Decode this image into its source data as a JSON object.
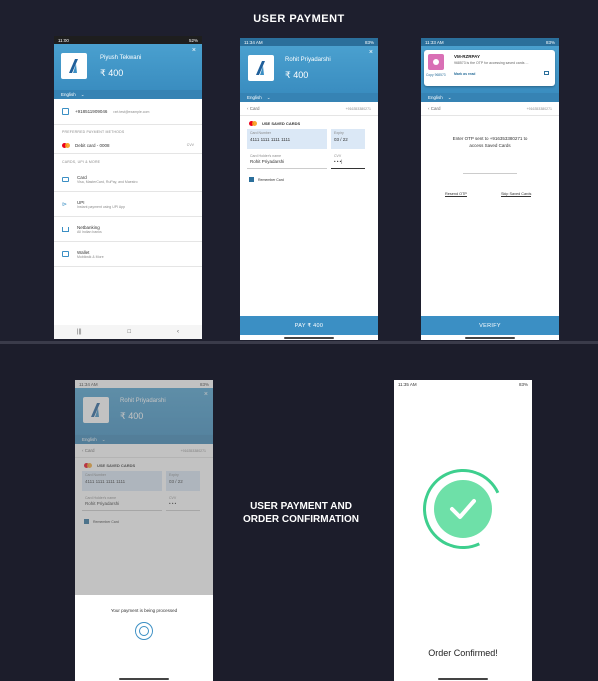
{
  "titles": {
    "main": "USER PAYMENT",
    "side": "USER PAYMENT AND ORDER CONFIRMATION"
  },
  "phone1": {
    "status_time": "11:00",
    "status_right": "52%",
    "name": "Piyush Tekwani",
    "amount": "₹ 400",
    "close": "×",
    "language": "English",
    "phone": "+918511909046",
    "email": "rzrt.test@example.com",
    "preferred_label": "PREFERRED PAYMENT METHODS",
    "debit_card": "Debit card - 0008",
    "cvv": "CVV",
    "cards_label": "CARDS, UPI & MORE",
    "methods": [
      {
        "title": "Card",
        "sub": "Visa, MasterCard, RuPay, and Maestro"
      },
      {
        "title": "UPI",
        "sub": "Instant payment using UPI App"
      },
      {
        "title": "Netbanking",
        "sub": "All Indian banks"
      },
      {
        "title": "Wallet",
        "sub": "Mobikwik & More"
      }
    ],
    "nav": [
      "|||",
      "□",
      "‹"
    ]
  },
  "phone2": {
    "status_time": "11:34 AM",
    "status_right": "83%",
    "name": "Rohit Priyadarshi",
    "amount": "₹ 400",
    "close": "×",
    "language": "English",
    "back_label": "‹  Card",
    "phone": "+916353380271",
    "saved_cards": "USE SAVED CARDS",
    "card_number_label": "Card Number",
    "card_number": "4111 1111 1111 1111",
    "expiry_label": "Expiry",
    "expiry": "03 / 22",
    "holder_label": "Card Holder's name",
    "holder": "Rohit Priyadarshi",
    "cvv_label": "CVV",
    "cvv_value": "• • •|",
    "remember": "Remember Card",
    "pay": "PAY ₹ 400"
  },
  "phone3": {
    "status_time": "11:33 AM",
    "status_right": "83%",
    "notif_sender": "VM-RZRPAY",
    "notif_text": "968573 is the OTP for accessing saved cards ...",
    "notif_action": "Mark as read",
    "notif_copy": "Copy 968573",
    "language": "English",
    "back_label": "‹  Card",
    "phone": "+916353380271",
    "otp_text": "Enter OTP sent to +916353380271 to access Saved Cards",
    "resend": "Resend OTP",
    "skip": "Skip Saved Cards",
    "verify": "VERIFY"
  },
  "phone4": {
    "status_time": "11:34 AM",
    "status_right": "83%",
    "name": "Rohit Priyadarshi",
    "amount": "₹ 400",
    "close": "×",
    "language": "English",
    "back_label": "‹  Card",
    "phone": "+916353380271",
    "saved_cards": "USE SAVED CARDS",
    "card_number_label": "Card Number",
    "card_number": "4111 1111 1111 1111",
    "expiry_label": "Expiry",
    "expiry": "03 / 22",
    "holder_label": "Card Holder's name",
    "holder": "Rohit Priyadarshi",
    "cvv_label": "CVV",
    "cvv_value": "• • •",
    "remember": "Remember Card",
    "processing": "Your payment is being processed"
  },
  "phone5": {
    "status_time": "11:35 AM",
    "status_right": "83%",
    "confirmed": "Order Confirmed!"
  },
  "colors": {
    "accent_blue": "#3b8fc4",
    "success_green": "#3ecf8e",
    "background": "#1c1d2b"
  }
}
